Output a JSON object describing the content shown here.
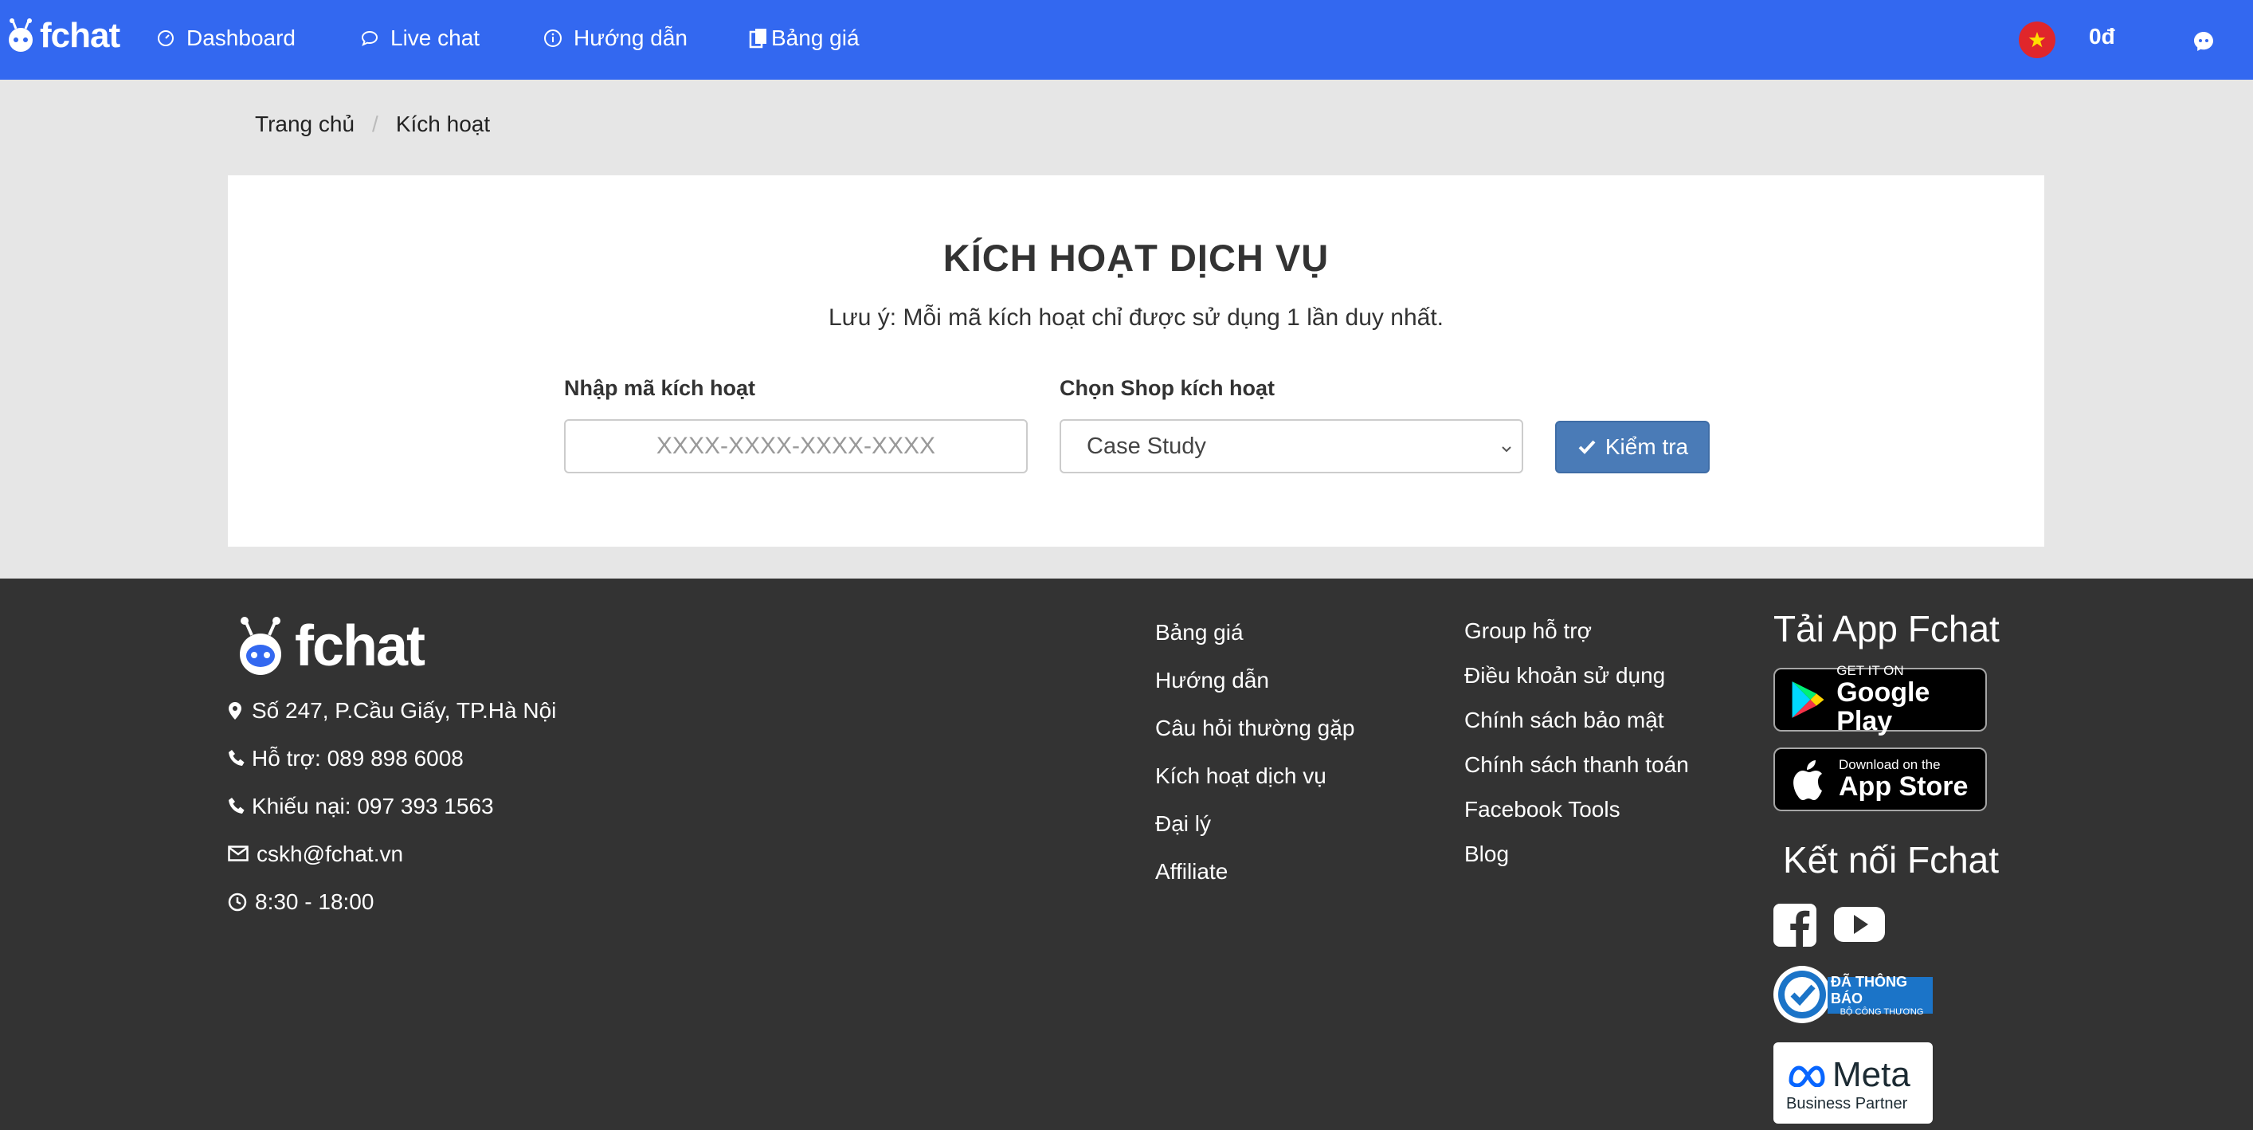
{
  "navbar": {
    "brand": "fchat",
    "items": [
      {
        "label": "Dashboard",
        "icon": "gauge-icon"
      },
      {
        "label": "Live chat",
        "icon": "chat-bubble-icon"
      },
      {
        "label": "Hướng dẫn",
        "icon": "info-icon"
      },
      {
        "label": "Bảng giá",
        "icon": "copy-icon"
      }
    ],
    "balance": "0đ",
    "language_flag": "vietnam-flag-icon"
  },
  "breadcrumb": {
    "home": "Trang chủ",
    "current": "Kích hoạt"
  },
  "activation": {
    "title": "KÍCH HOẠT DỊCH VỤ",
    "note": "Lưu ý: Mỗi mã kích hoạt chỉ được sử dụng 1 lần duy nhất.",
    "code_label": "Nhập mã kích hoạt",
    "code_placeholder": "XXXX-XXXX-XXXX-XXXX",
    "code_value": "",
    "shop_label": "Chọn Shop kích hoạt",
    "shop_selected": "Case Study",
    "check_button": "Kiểm tra"
  },
  "footer": {
    "brand": "fchat",
    "contacts": [
      {
        "icon": "map-marker-icon",
        "text": "Số 247, P.Cầu Giấy, TP.Hà Nội"
      },
      {
        "icon": "phone-icon",
        "text": "Hỗ trợ: 089 898 6008"
      },
      {
        "icon": "phone-icon",
        "text": "Khiếu nại: 097 393 1563"
      },
      {
        "icon": "envelope-icon",
        "text": "cskh@fchat.vn"
      },
      {
        "icon": "clock-icon",
        "text": "8:30 - 18:00"
      }
    ],
    "links_col1": [
      "Bảng giá",
      "Hướng dẫn",
      "Câu hỏi thường gặp",
      "Kích hoạt dịch vụ",
      "Đại lý",
      "Affiliate"
    ],
    "links_col2": [
      "Group hỗ trợ",
      "Điều khoản sử dụng",
      "Chính sách bảo mật",
      "Chính sách thanh toán",
      "Facebook Tools",
      "Blog"
    ],
    "app_heading": "Tải App Fchat",
    "google_play": {
      "small": "GET IT ON",
      "big": "Google Play"
    },
    "app_store": {
      "small": "Download on the",
      "big": "App Store"
    },
    "connect_heading": "Kết nối Fchat",
    "bct_badge": {
      "line1": "ĐÃ THÔNG BÁO",
      "line2": "BỘ CÔNG THƯƠNG"
    },
    "meta_badge": {
      "brand": "Meta",
      "sub": "Business Partner"
    }
  },
  "colors": {
    "navbar_bg": "#3368f0",
    "footer_bg": "#333333",
    "button_bg": "#4a7bb7",
    "page_bg": "#e6e6e6"
  }
}
